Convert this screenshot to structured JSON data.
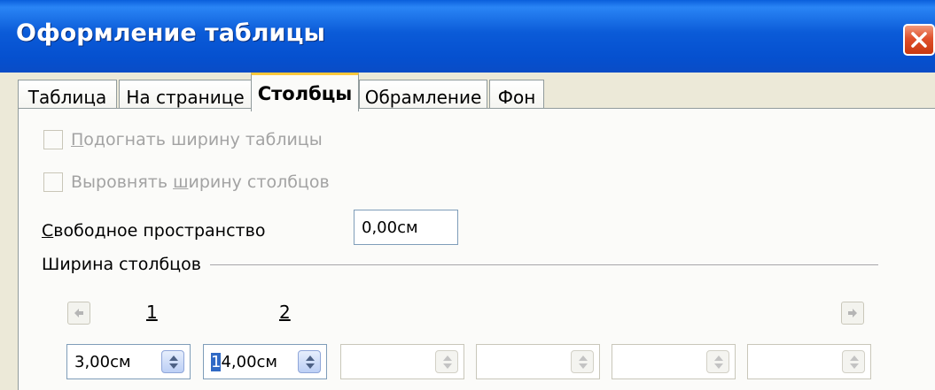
{
  "window": {
    "title": "Оформление таблицы"
  },
  "tabs": [
    {
      "label": "Таблица"
    },
    {
      "label": "На странице"
    },
    {
      "label": "Столбцы"
    },
    {
      "label": "Обрамление"
    },
    {
      "label": "Фон"
    }
  ],
  "options": {
    "fit_width": {
      "label_u": "П",
      "label_rest": "одогнать ширину таблицы",
      "checked": false,
      "enabled": false
    },
    "equal_width": {
      "label_pre": "Выровнять ",
      "label_u": "ш",
      "label_rest": "ирину столбцов",
      "checked": false,
      "enabled": false
    }
  },
  "free_space": {
    "label_u": "С",
    "label_rest": "вободное пространство",
    "value": "0,00см"
  },
  "column_widths": {
    "group_label": "Ширина столбцов",
    "col_numbers": [
      "1",
      "2"
    ],
    "values": [
      "3,00см",
      "14,00см",
      "",
      "",
      "",
      ""
    ],
    "value2_sel": "1",
    "value2_rest": "4,00см"
  },
  "icons": {
    "close": "close-icon",
    "left_arrow": "arrow-left-icon",
    "right_arrow": "arrow-right-icon",
    "spin": "spin-updown-icon"
  },
  "colors": {
    "titlebar": "#0b5bd8",
    "active_tab_accent": "#ffc83c",
    "close": "#e0502c"
  }
}
